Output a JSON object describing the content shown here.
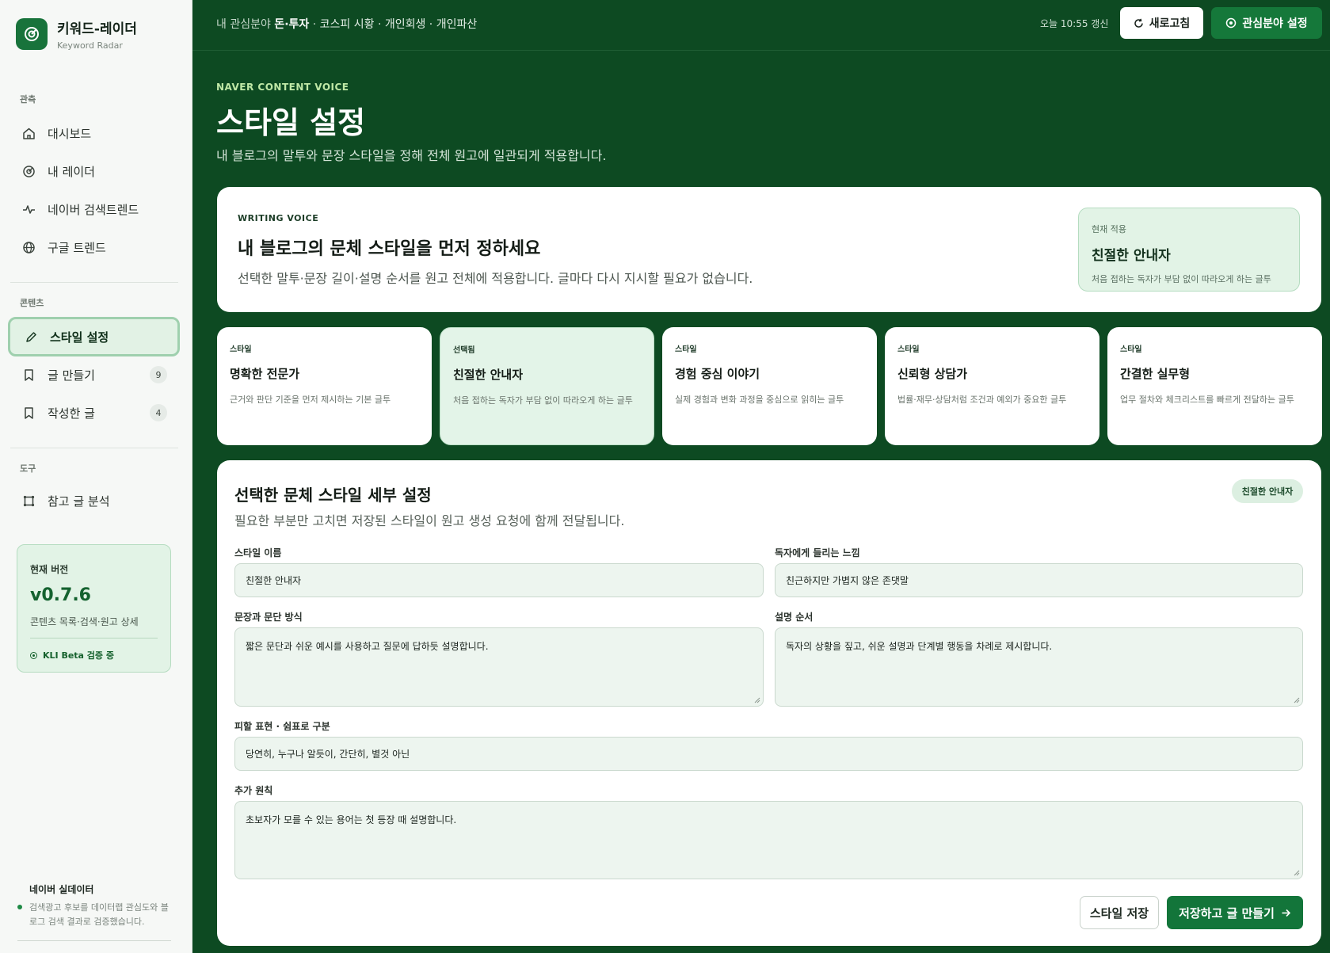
{
  "brand": {
    "title": "키워드-레이더",
    "subtitle": "Keyword Radar"
  },
  "sidebar": {
    "sections": {
      "observe": "관측",
      "content": "콘텐츠",
      "tools": "도구"
    },
    "observe_items": [
      {
        "label": "대시보드",
        "icon": "home-icon"
      },
      {
        "label": "내 레이더",
        "icon": "radar-icon"
      },
      {
        "label": "네이버 검색트렌드",
        "icon": "pulse-icon"
      },
      {
        "label": "구글 트렌드",
        "icon": "globe-icon"
      }
    ],
    "content_items": [
      {
        "label": "스타일 설정",
        "icon": "pencil-icon",
        "active": true
      },
      {
        "label": "글 만들기",
        "icon": "bookmark-icon",
        "badge": "9"
      },
      {
        "label": "작성한 글",
        "icon": "bookmark-icon",
        "badge": "4"
      }
    ],
    "tools_items": [
      {
        "label": "참고 글 분석",
        "icon": "frame-icon"
      }
    ],
    "version_card": {
      "label": "현재 버전",
      "version": "v0.7.6",
      "desc": "콘텐츠 목록·검색·원고 상세",
      "status": "KLI Beta 검증 중"
    },
    "footer": {
      "title": "네이버 실데이터",
      "desc": "검색광고 후보를 데이터랩 관심도와 블로그 검색 결과로 검증했습니다."
    }
  },
  "topbar": {
    "crumb_prefix": "내 관심분야",
    "crumb_strong": "돈·투자",
    "crumb_sep": "·",
    "crumb_rest": "코스피 시황 · 개인회생 · 개인파산",
    "updated": "오늘 10:55 갱신",
    "refresh_label": "새로고침",
    "interest_label": "관심분야 설정"
  },
  "header": {
    "eyebrow": "NAVER CONTENT VOICE",
    "title": "스타일 설정",
    "desc": "내 블로그의 말투와 문장 스타일을 정해 전체 원고에 일관되게 적용합니다."
  },
  "voice": {
    "eyebrow": "WRITING VOICE",
    "title": "내 블로그의 문체 스타일을 먼저 정하세요",
    "desc": "선택한 말투·문장 길이·설명 순서를 원고 전체에 적용합니다. 글마다 다시 지시할 필요가 없습니다.",
    "current": {
      "label": "현재 적용",
      "title": "친절한 안내자",
      "desc": "처음 접하는 독자가 부담 없이 따라오게 하는 글투"
    }
  },
  "styles": [
    {
      "tag": "스타일",
      "title": "명확한 전문가",
      "desc": "근거와 판단 기준을 먼저 제시하는 기본 글투",
      "selected": false
    },
    {
      "tag": "선택됨",
      "title": "친절한 안내자",
      "desc": "처음 접하는 독자가 부담 없이 따라오게 하는 글투",
      "selected": true
    },
    {
      "tag": "스타일",
      "title": "경험 중심 이야기",
      "desc": "실제 경험과 변화 과정을 중심으로 읽히는 글투",
      "selected": false
    },
    {
      "tag": "스타일",
      "title": "신뢰형 상담가",
      "desc": "법률·재무·상담처럼 조건과 예외가 중요한 글투",
      "selected": false
    },
    {
      "tag": "스타일",
      "title": "간결한 실무형",
      "desc": "업무 절차와 체크리스트를 빠르게 전달하는 글투",
      "selected": false
    }
  ],
  "detail": {
    "title": "선택한 문체 스타일 세부 설정",
    "desc": "필요한 부분만 고치면 저장된 스타일이 원고 생성 요청에 함께 전달됩니다.",
    "badge": "친절한 안내자",
    "fields": {
      "name_label": "스타일 이름",
      "name_value": "친절한 안내자",
      "feel_label": "독자에게 들리는 느낌",
      "feel_value": "친근하지만 가볍지 않은 존댓말",
      "sentence_label": "문장과 문단 방식",
      "sentence_value": "짧은 문단과 쉬운 예시를 사용하고 질문에 답하듯 설명합니다.",
      "order_label": "설명 순서",
      "order_value": "독자의 상황을 짚고, 쉬운 설명과 단계별 행동을 차례로 제시합니다.",
      "avoid_label": "피할 표현 · 쉼표로 구분",
      "avoid_value": "당연히, 누구나 알듯이, 간단히, 별것 아닌",
      "extra_label": "추가 원칙",
      "extra_value": "초보자가 모를 수 있는 용어는 첫 등장 때 설명합니다."
    },
    "save_label": "스타일 저장",
    "make_label": "저장하고 글 만들기"
  },
  "colors": {
    "background": "#0d4a22",
    "accent": "#15783a",
    "active_bg": "#e2f2e5",
    "eyebrow": "#bfe8a6"
  }
}
